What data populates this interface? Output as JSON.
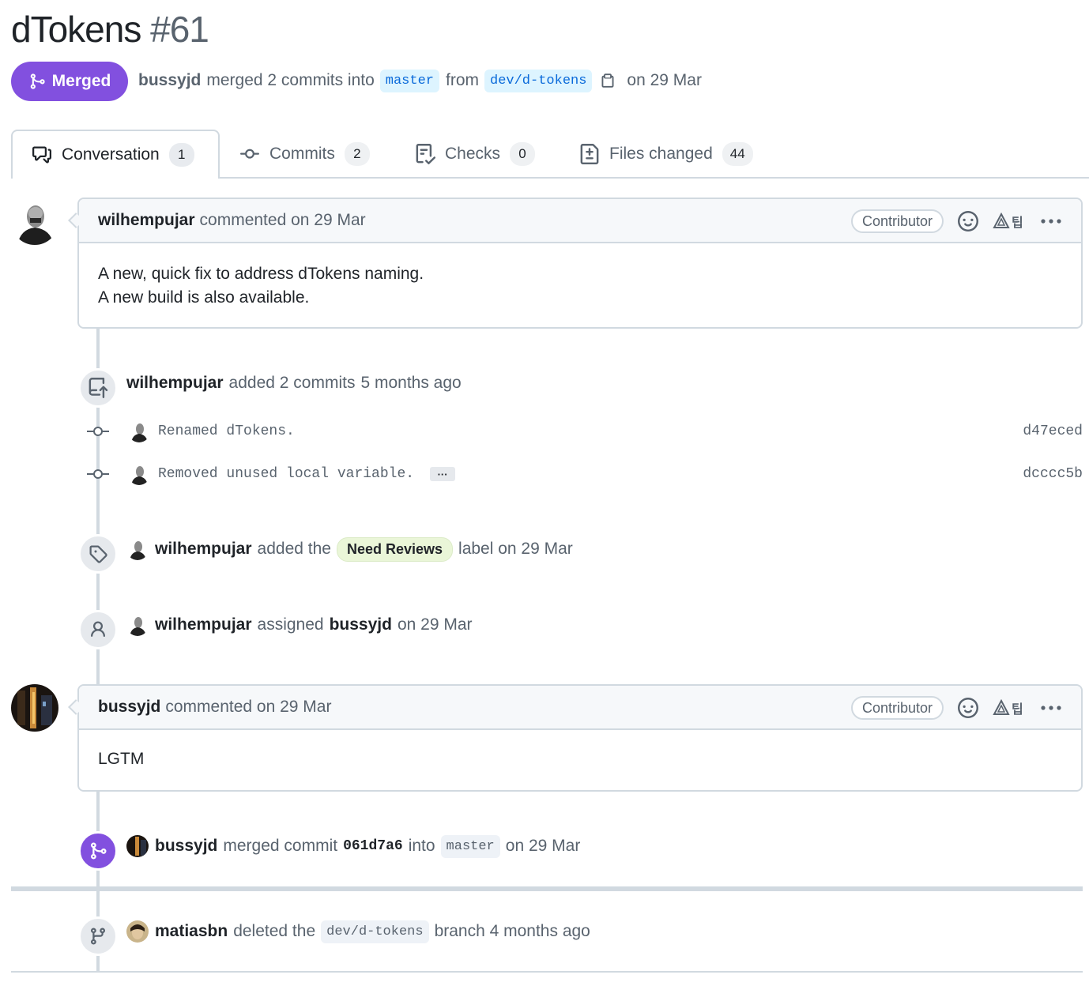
{
  "pr": {
    "title": "dTokens",
    "number": "#61",
    "state": "Merged",
    "author": "bussyjd",
    "merge_text": "merged 2 commits into",
    "base_branch": "master",
    "from_text": "from",
    "head_branch": "dev/d-tokens",
    "date_text": "on 29 Mar"
  },
  "tabs": [
    {
      "label": "Conversation",
      "count": "1",
      "icon": "comment-discussion-icon"
    },
    {
      "label": "Commits",
      "count": "2",
      "icon": "git-commit-icon"
    },
    {
      "label": "Checks",
      "count": "0",
      "icon": "checklist-icon"
    },
    {
      "label": "Files changed",
      "count": "44",
      "icon": "file-diff-icon"
    }
  ],
  "comments": [
    {
      "author": "wilhempujar",
      "action": "commented on 29 Mar",
      "role": "Contributor",
      "body_lines": [
        "A new, quick fix to address dTokens naming.",
        "A new build is also available."
      ]
    },
    {
      "author": "bussyjd",
      "action": "commented on 29 Mar",
      "role": "Contributor",
      "body_lines": [
        "LGTM"
      ]
    }
  ],
  "events": {
    "commits_added": {
      "actor": "wilhempujar",
      "text": "added 2 commits",
      "time": "5 months ago"
    },
    "commits": [
      {
        "message": "Renamed dTokens.",
        "sha": "d47eced"
      },
      {
        "message": "Removed unused local variable.",
        "sha": "dcccc5b",
        "ellipsis": "···"
      }
    ],
    "label_added": {
      "actor": "wilhempujar",
      "pre": "added the",
      "label": "Need Reviews",
      "post": "label on 29 Mar"
    },
    "assigned": {
      "actor": "wilhempujar",
      "pre": "assigned",
      "assignee": "bussyjd",
      "post": "on 29 Mar"
    },
    "merged": {
      "actor": "bussyjd",
      "pre": "merged commit",
      "sha": "061d7a6",
      "into": "into",
      "branch": "master",
      "post": "on 29 Mar"
    },
    "branch_deleted": {
      "actor": "matiasbn",
      "pre": "deleted the",
      "branch": "dev/d-tokens",
      "post": "branch 4 months ago"
    }
  },
  "colors": {
    "merged_purple": "#8250df",
    "branch_bg": "#ddf4ff",
    "branch_fg": "#0969da",
    "label_bg": "#eaf6d8",
    "border": "#d1d9e0"
  }
}
